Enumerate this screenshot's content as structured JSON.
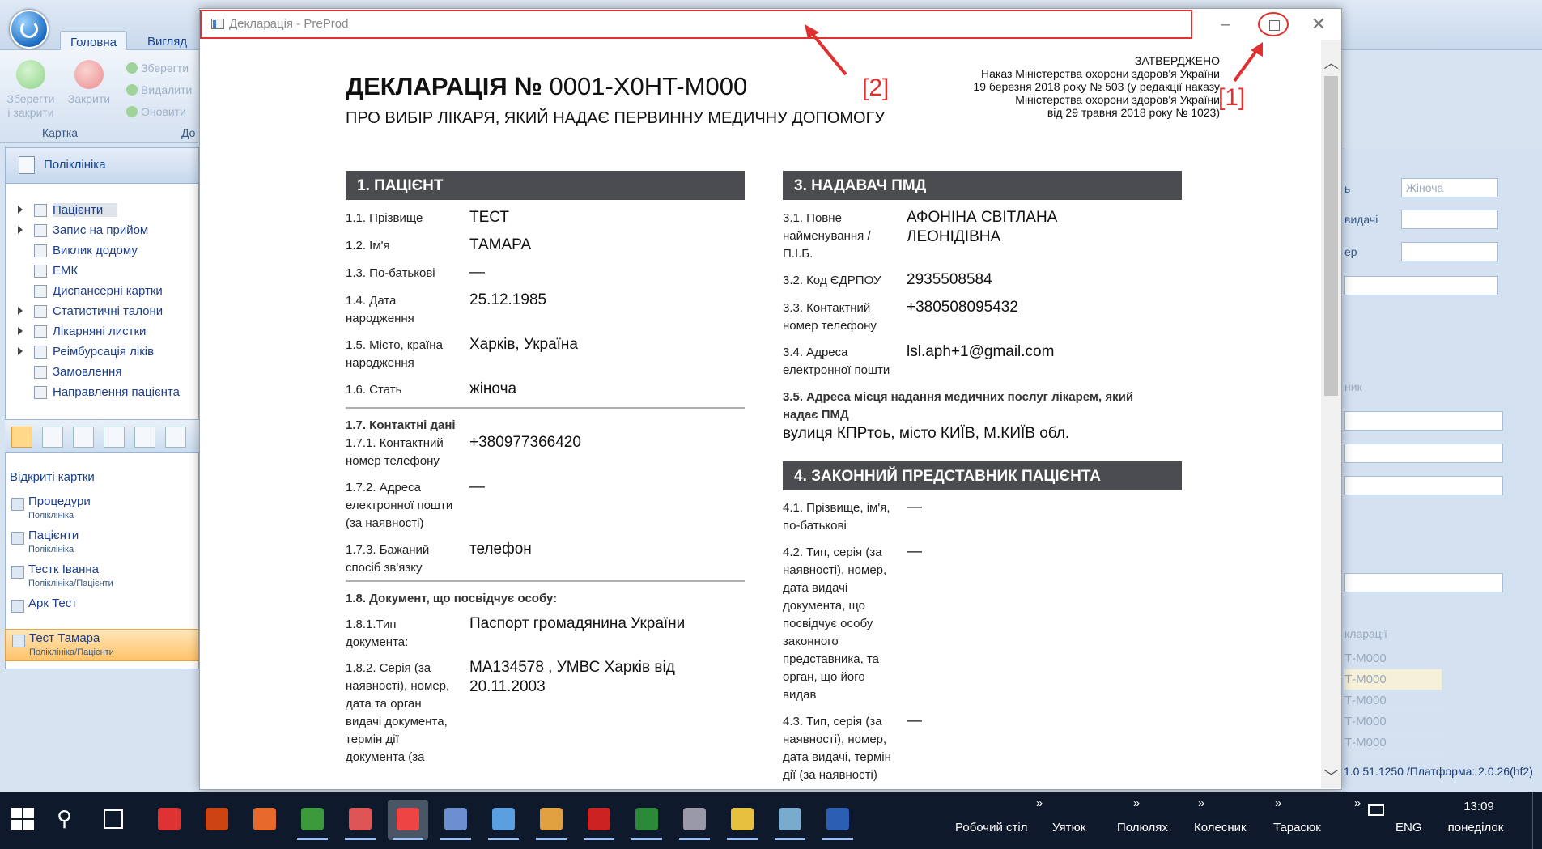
{
  "app": {
    "tabs": [
      "Головна",
      "Вигляд"
    ],
    "ribbon": {
      "save_close": "Зберегти і закрити",
      "close": "Закрити",
      "save": "Зберегти",
      "delete": "Видалити",
      "refresh": "Оновити",
      "group_card": "Картка",
      "group_other": "До"
    },
    "sidebar": {
      "header": "Поліклініка",
      "items": [
        {
          "label": "Пацієнти",
          "expandable": true,
          "selected": true
        },
        {
          "label": "Запис на прийом",
          "expandable": true
        },
        {
          "label": "Виклик додому",
          "expandable": false
        },
        {
          "label": "ЕМК",
          "expandable": false
        },
        {
          "label": "Диспансерні картки",
          "expandable": false
        },
        {
          "label": "Статистичні талони",
          "expandable": true
        },
        {
          "label": "Лікарняні листки",
          "expandable": true
        },
        {
          "label": "Реімбурсація ліків",
          "expandable": true
        },
        {
          "label": "Замовлення",
          "expandable": false
        },
        {
          "label": "Направлення пацієнта",
          "expandable": false
        }
      ]
    },
    "open_cards": {
      "title": "Відкриті картки",
      "items": [
        {
          "name": "Процедури",
          "sub": "Поліклініка"
        },
        {
          "name": "Пацієнти",
          "sub": "Поліклініка"
        },
        {
          "name": "Тестк Іванна",
          "sub": "Поліклініка/Пацієнти"
        },
        {
          "name": "Арк Тест",
          "sub": ""
        },
        {
          "name": "Тест Тамара",
          "sub": "Поліклініка/Пацієнти",
          "active": true
        }
      ]
    },
    "right_panel": {
      "labels": [
        "ь",
        "видачі",
        "ер",
        "ник"
      ],
      "gender_value": "Жіноча",
      "grid_header": "кларації",
      "grid_rows": [
        "Т-M000",
        "Т-M000",
        "Т-M000",
        "Т-M000",
        "Т-M000"
      ]
    },
    "version": "1.0.51.1250 /Платформа: 2.0.26(hf2)"
  },
  "modal": {
    "title": "Декларація - PreProd",
    "annotations": {
      "title_marker": "[2]",
      "maximize_marker": "[1]"
    }
  },
  "declaration": {
    "title_bold": "ДЕКЛАРАЦІЯ №",
    "number": "0001-X0HT-M000",
    "subtitle": "ПРО ВИБІР ЛІКАРЯ, ЯКИЙ НАДАЄ ПЕРВИННУ МЕДИЧНУ ДОПОМОГУ",
    "approved": [
      "ЗАТВЕРДЖЕНО",
      "Наказ Міністерства охорони здоров'я України",
      "19 березня 2018 року № 503 (у редакції наказу",
      "Міністерства охорони здоров'я України",
      "від 29 травня 2018 року № 1023)"
    ],
    "patient": {
      "header": "1. ПАЦІЄНТ",
      "surname_label": "1.1. Прізвище",
      "surname": "ТЕСТ",
      "name_label": "1.2. Ім'я",
      "name": "ТАМАРА",
      "patronymic_label": "1.3. По-батькові",
      "patronymic": "—",
      "birth_label": [
        "1.4. Дата",
        "народження"
      ],
      "birth": "25.12.1985",
      "birthplace_label": [
        "1.5. Місто, країна",
        "народження"
      ],
      "birthplace": "Харків, Україна",
      "sex_label": "1.6. Стать",
      "sex": "жіноча",
      "contacts_header": "1.7. Контактні дані",
      "phone_label": [
        "1.7.1. Контактний",
        "номер телефону"
      ],
      "phone": "+380977366420",
      "email_label": [
        "1.7.2. Адреса",
        "електронної пошти",
        "(за наявності)"
      ],
      "email": "—",
      "contact_method_label": [
        "1.7.3. Бажаний",
        "спосіб зв'язку"
      ],
      "contact_method": "телефон",
      "document_header": "1.8. Документ, що посвідчує особу:",
      "doc_type_label": [
        "1.8.1.Тип",
        "документа:"
      ],
      "doc_type": "Паспорт громадянина України",
      "doc_details_label": [
        "1.8.2. Серія (за",
        "наявності), номер,",
        "дата та орган",
        "видачі документа,",
        "термін дії",
        "документа (за"
      ],
      "doc_details": [
        "МА134578 , УМВС Харків від",
        "20.11.2003"
      ]
    },
    "provider": {
      "header": "3. НАДАВАЧ ПМД",
      "fullname_label": [
        "3.1. Повне",
        "найменування /",
        "П.І.Б."
      ],
      "fullname": [
        "АФОНІНА СВІТЛАНА",
        "ЛЕОНІДІВНА"
      ],
      "edrpou_label": "3.2. Код ЄДРПОУ",
      "edrpou": "2935508584",
      "phone_label": [
        "3.3. Контактний",
        "номер телефону"
      ],
      "phone": "+380508095432",
      "email_label": [
        "3.4. Адреса",
        "електронної пошти"
      ],
      "email": "lsl.aph+1@gmail.com",
      "address_label": [
        "3.5. Адреса місця надання медичних послуг лікарем, який",
        "надає ПМД"
      ],
      "address": "вулиця КПРтоь, місто КИЇВ, М.КИЇВ обл."
    },
    "representative": {
      "header": "4. ЗАКОННИЙ ПРЕДСТАВНИК ПАЦІЄНТА",
      "name_label": [
        "4.1. Прізвище, ім'я,",
        "по-батькові"
      ],
      "name": "—",
      "doc_label": [
        "4.2. Тип, серія (за",
        "наявності), номер,",
        "дата видачі",
        "документа, що",
        "посвідчує особу",
        "законного",
        "представника, та",
        "орган, що його",
        "видав"
      ],
      "doc": "—",
      "doc2_label": [
        "4.3. Тип, серія (за",
        "наявності), номер,",
        "дата видачі, термін",
        "дії (за наявності)"
      ],
      "doc2": "—"
    }
  },
  "taskbar": {
    "toolbars": [
      "Робочий стіл",
      "Уятюк",
      "Полюлях",
      "Колесник",
      "Тарасюк"
    ],
    "lang": "ENG",
    "time": "13:09",
    "day": "понеділок"
  }
}
